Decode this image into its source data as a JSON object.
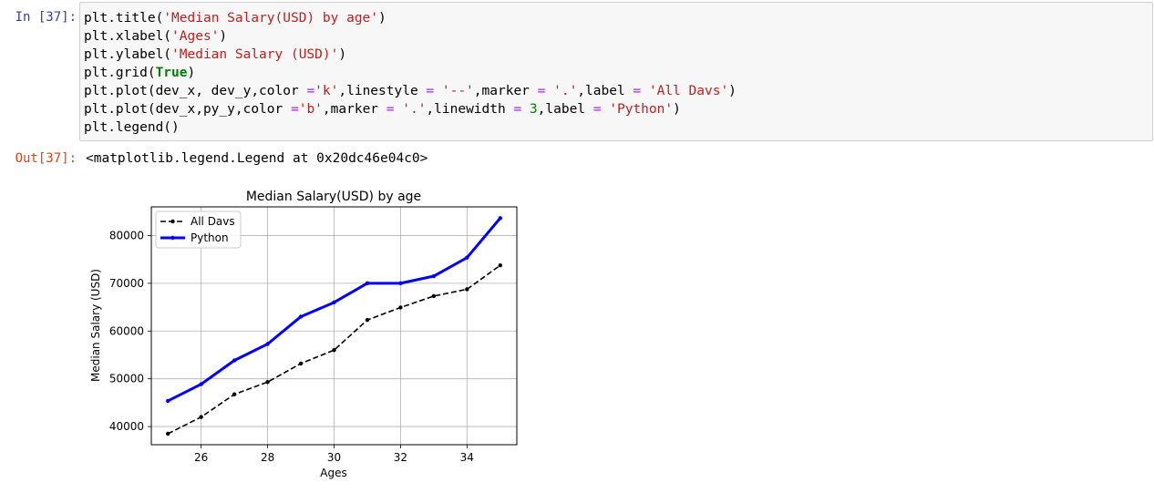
{
  "cell": {
    "in_prompt": "In [37]:",
    "out_prompt": "Out[37]:",
    "code": [
      {
        "parts": [
          [
            "",
            "plt.title("
          ],
          [
            "s",
            "'Median Salary(USD) by age'"
          ],
          [
            "",
            ")"
          ]
        ]
      },
      {
        "parts": [
          [
            "",
            "plt.xlabel("
          ],
          [
            "s",
            "'Ages'"
          ],
          [
            "",
            ")"
          ]
        ]
      },
      {
        "parts": [
          [
            "",
            "plt.ylabel("
          ],
          [
            "s",
            "'Median Salary (USD)'"
          ],
          [
            "",
            ")"
          ]
        ]
      },
      {
        "parts": [
          [
            "",
            "plt.grid("
          ],
          [
            "kw",
            "True"
          ],
          [
            "",
            ")"
          ]
        ]
      },
      {
        "parts": [
          [
            "",
            "plt.plot(dev_x, dev_y,color "
          ],
          [
            "op",
            "="
          ],
          [
            "s",
            "'k'"
          ],
          [
            "",
            ",linestyle "
          ],
          [
            "op",
            "="
          ],
          [
            "s",
            " '--'"
          ],
          [
            "",
            ",marker "
          ],
          [
            "op",
            "="
          ],
          [
            "s",
            " '.'"
          ],
          [
            "",
            ",label "
          ],
          [
            "op",
            "="
          ],
          [
            "s",
            " 'All Davs'"
          ],
          [
            "",
            ")"
          ]
        ]
      },
      {
        "parts": [
          [
            "",
            "plt.plot(dev_x,py_y,color "
          ],
          [
            "op",
            "="
          ],
          [
            "s",
            "'b'"
          ],
          [
            "",
            ",marker "
          ],
          [
            "op",
            "="
          ],
          [
            "s",
            " '.'"
          ],
          [
            "",
            ",linewidth "
          ],
          [
            "op",
            "="
          ],
          [
            "num",
            " 3"
          ],
          [
            "",
            ",label "
          ],
          [
            "op",
            "="
          ],
          [
            "s",
            " 'Python'"
          ],
          [
            "",
            ")"
          ]
        ]
      },
      {
        "parts": [
          [
            "",
            "plt.legend()"
          ]
        ]
      }
    ],
    "output_text": "<matplotlib.legend.Legend at 0x20dc46e04c0>"
  },
  "chart_data": {
    "type": "line",
    "title": "Median Salary(USD) by age",
    "xlabel": "Ages",
    "ylabel": "Median Salary (USD)",
    "x": [
      25,
      26,
      27,
      28,
      29,
      30,
      31,
      32,
      33,
      34,
      35
    ],
    "xticks": [
      26,
      28,
      30,
      32,
      34
    ],
    "yticks": [
      40000,
      50000,
      60000,
      70000,
      80000
    ],
    "xlim": [
      24.5,
      35.5
    ],
    "ylim": [
      36200,
      86000
    ],
    "grid": true,
    "legend_position": "upper left",
    "series": [
      {
        "name": "All Davs",
        "color": "#000000",
        "linestyle": "dashed",
        "marker": "point",
        "values": [
          38496,
          42000,
          46752,
          49320,
          53200,
          56000,
          62316,
          64928,
          67317,
          68748,
          73752
        ]
      },
      {
        "name": "Python",
        "color": "#0000ff",
        "linestyle": "solid",
        "marker": "point",
        "linewidth": 3,
        "values": [
          45372,
          48876,
          53850,
          57287,
          63016,
          65998,
          70003,
          70000,
          71496,
          75370,
          83640
        ]
      }
    ]
  }
}
